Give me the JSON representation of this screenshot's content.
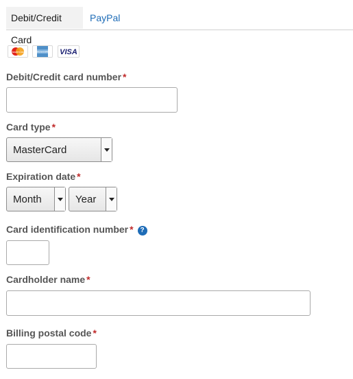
{
  "tabs": [
    {
      "label": "Debit/Credit Card",
      "active": true
    },
    {
      "label": "PayPal",
      "active": false
    }
  ],
  "card_logos": [
    {
      "name": "mastercard",
      "text": "MasterCard"
    },
    {
      "name": "amex",
      "text": "AMERICAN EXPRESS"
    },
    {
      "name": "visa",
      "text": "VISA"
    }
  ],
  "form": {
    "required_marker": "*",
    "card_number": {
      "label": "Debit/Credit card number",
      "value": ""
    },
    "card_type": {
      "label": "Card type",
      "selected": "MasterCard"
    },
    "expiration": {
      "label": "Expiration date",
      "month": "Month",
      "year": "Year"
    },
    "cvv": {
      "label": "Card identification number",
      "help_glyph": "?",
      "value": ""
    },
    "cardholder": {
      "label": "Cardholder name",
      "value": ""
    },
    "postal": {
      "label": "Billing postal code",
      "value": ""
    }
  },
  "colors": {
    "link": "#1e6cb7",
    "required": "#c02a2a",
    "active_tab_bg": "#f2f2f2"
  }
}
